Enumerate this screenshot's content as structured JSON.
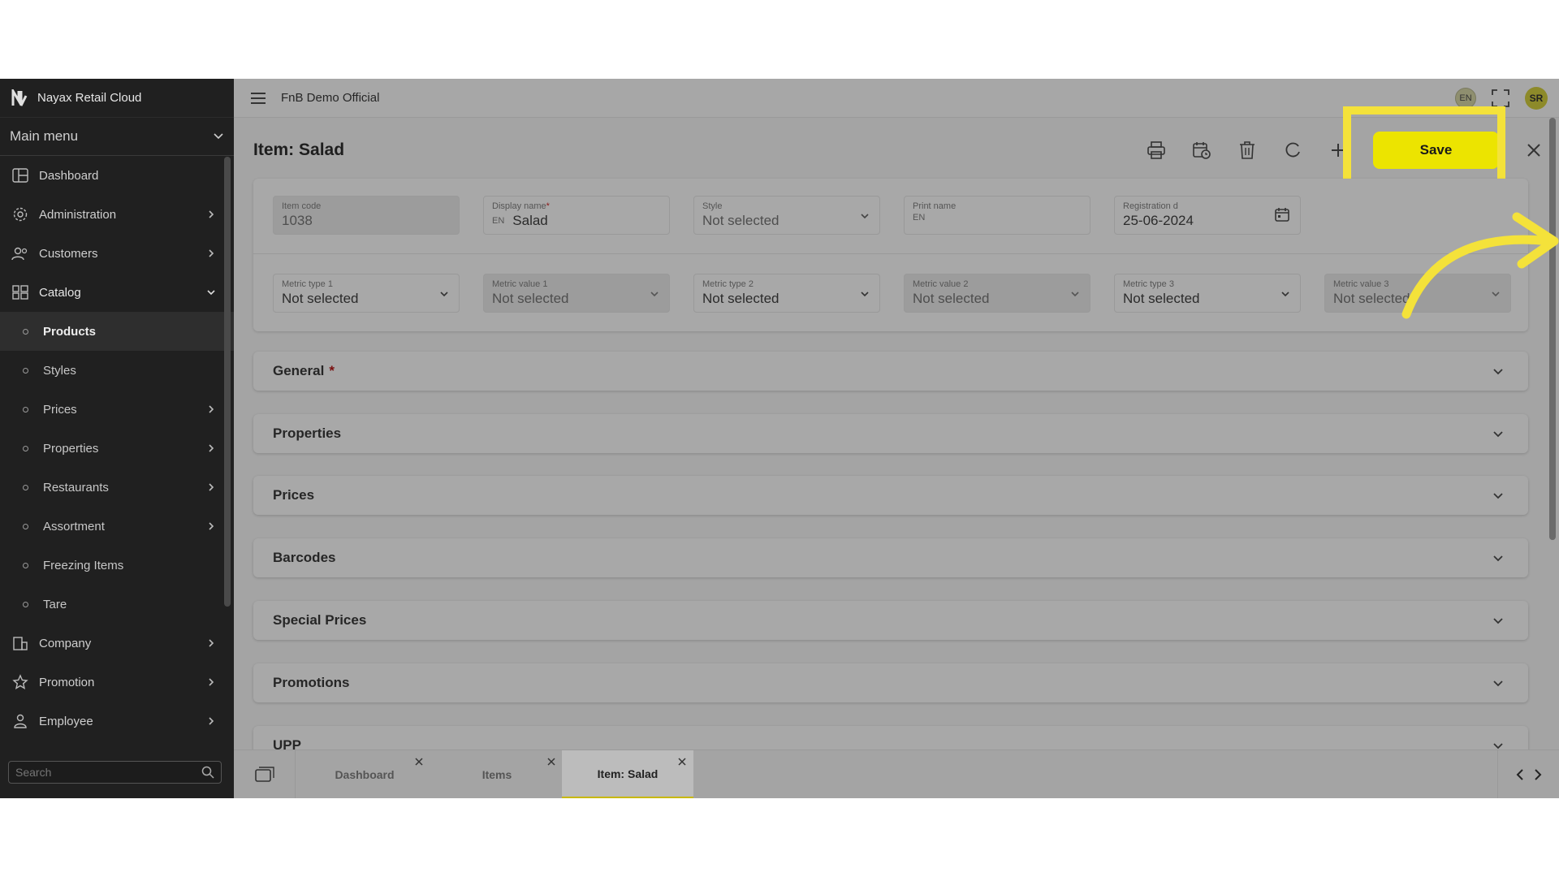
{
  "app": {
    "brand": "Nayax Retail Cloud",
    "org": "FnB Demo Official"
  },
  "sidebar": {
    "main_menu": "Main menu",
    "items": [
      {
        "label": "Dashboard",
        "icon": "dashboard-icon"
      },
      {
        "label": "Administration",
        "icon": "gear-icon"
      },
      {
        "label": "Customers",
        "icon": "users-icon"
      },
      {
        "label": "Catalog",
        "icon": "grid-icon"
      },
      {
        "label": "Company",
        "icon": "building-icon"
      },
      {
        "label": "Promotion",
        "icon": "star-icon"
      },
      {
        "label": "Employee",
        "icon": "person-icon"
      }
    ],
    "catalog_sub": [
      {
        "label": "Products"
      },
      {
        "label": "Styles"
      },
      {
        "label": "Prices"
      },
      {
        "label": "Properties"
      },
      {
        "label": "Restaurants"
      },
      {
        "label": "Assortment"
      },
      {
        "label": "Freezing Items"
      },
      {
        "label": "Tare"
      }
    ],
    "search_placeholder": "Search"
  },
  "header": {
    "lang": "EN",
    "avatar": "SR"
  },
  "page": {
    "title": "Item: Salad",
    "save_label": "Save"
  },
  "form": {
    "item_code": {
      "label": "Item code",
      "value": "1038"
    },
    "display_name": {
      "label": "Display name",
      "lang": "EN",
      "value": "Salad"
    },
    "style": {
      "label": "Style",
      "value": "Not selected"
    },
    "print_name": {
      "label": "Print name",
      "lang": "EN",
      "value": ""
    },
    "registration_date": {
      "label": "Registration d",
      "value": "25-06-2024"
    },
    "metric_type_1": {
      "label": "Metric type 1",
      "value": "Not selected"
    },
    "metric_value_1": {
      "label": "Metric value 1",
      "value": "Not selected"
    },
    "metric_type_2": {
      "label": "Metric type 2",
      "value": "Not selected"
    },
    "metric_value_2": {
      "label": "Metric value 2",
      "value": "Not selected"
    },
    "metric_type_3": {
      "label": "Metric type 3",
      "value": "Not selected"
    },
    "metric_value_3": {
      "label": "Metric value 3",
      "value": "Not selected"
    }
  },
  "sections": [
    {
      "title": "General"
    },
    {
      "title": "Properties"
    },
    {
      "title": "Prices"
    },
    {
      "title": "Barcodes"
    },
    {
      "title": "Special Prices"
    },
    {
      "title": "Promotions"
    },
    {
      "title": "UPP"
    }
  ],
  "tabs": [
    {
      "label": "Dashboard"
    },
    {
      "label": "Items"
    },
    {
      "label": "Item: Salad"
    }
  ],
  "colors": {
    "accent": "#ece400",
    "highlight": "#f4e23a",
    "sidebar_bg": "#202020"
  }
}
